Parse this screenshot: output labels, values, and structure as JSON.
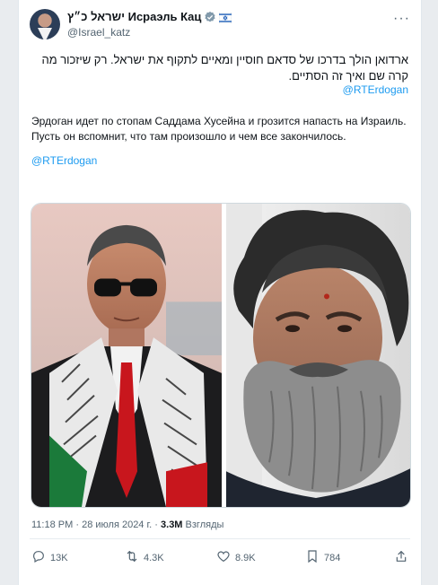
{
  "author": {
    "display_name": "ישראל כ״ץ Исраэль Кац",
    "handle": "@Israel_katz"
  },
  "post": {
    "hebrew_text": "ארדואן הולך בדרכו של סדאם חוסיין ומאיים לתקוף את ישראל. רק שיזכור מה קרה שם ואיך זה הסתיים.",
    "hebrew_mention": "@RTErdogan",
    "russian_text": "Эрдоган идет по стопам Саддама Хусейна и грозится напасть на Израиль. Пусть он вспомнит, что там произошло и чем все закончилось.",
    "russian_mention": "@RTErdogan"
  },
  "meta": {
    "time": "11:18 PM",
    "date": "28 июля 2024 г.",
    "views_count": "3.3M",
    "views_label": "Взгляды"
  },
  "actions": {
    "replies": "13K",
    "retweets": "4.3K",
    "likes": "8.9K",
    "bookmarks": "784"
  },
  "icons": {
    "verified": "verified-badge-icon",
    "flag": "israel-flag-icon",
    "more": "more-dots-icon",
    "reply": "reply-bubble-icon",
    "retweet": "retweet-icon",
    "like": "heart-icon",
    "bookmark": "bookmark-icon",
    "share": "share-icon"
  },
  "colors": {
    "link": "#1d9bf0",
    "secondary_text": "#536471",
    "verified_gray": "#829aab"
  }
}
